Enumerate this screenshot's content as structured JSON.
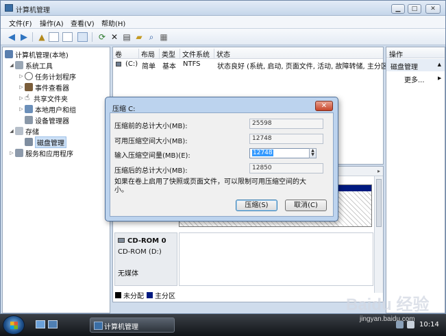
{
  "window": {
    "title": "计算机管理",
    "min": "▁",
    "max": "□",
    "close": "✕"
  },
  "menu": [
    "文件(F)",
    "操作(A)",
    "查看(V)",
    "帮助(H)"
  ],
  "tree": {
    "root": "计算机管理(本地)",
    "system_tools": "系统工具",
    "task_scheduler": "任务计划程序",
    "event_viewer": "事件查看器",
    "shared_folders": "共享文件夹",
    "local_users": "本地用户和组",
    "device_manager": "设备管理器",
    "storage": "存储",
    "disk_management": "磁盘管理",
    "services": "服务和应用程序"
  },
  "volumes": {
    "headers": [
      "卷",
      "布局",
      "类型",
      "文件系统",
      "状态"
    ],
    "row": {
      "volume": "(C:)",
      "layout": "简单",
      "type": "基本",
      "fs": "NTFS",
      "status": "状态良好 (系统, 启动, 页面文件, 活动, 故障转储, 主分区)"
    }
  },
  "disks": {
    "cdrom_name": "CD-ROM 0",
    "cdrom_drive": "CD-ROM (D:)",
    "no_media": "无媒体",
    "legend_unallocated": "未分配",
    "legend_primary": "主分区"
  },
  "actions": {
    "header": "操作",
    "section": "磁盘管理",
    "more": "更多..."
  },
  "dialog": {
    "title": "压缩 C:",
    "close": "✕",
    "total_before_label": "压缩前的总计大小(MB):",
    "total_before_value": "25598",
    "available_label": "可用压缩空间大小(MB):",
    "available_value": "12748",
    "input_label": "输入压缩空间量(MB)(E):",
    "input_value": "12748",
    "total_after_label": "压缩后的总计大小(MB):",
    "total_after_value": "12850",
    "note": "如果在卷上启用了快照或页面文件，可以限制可用压缩空间的大小。",
    "shrink_button": "压缩(S)",
    "cancel_button": "取消(C)"
  },
  "taskbar": {
    "task": "计算机管理",
    "time": "10:14"
  },
  "watermark": {
    "logo": "Baidu 经验",
    "url": "jingyan.baidu.com"
  },
  "colors": {
    "unallocated": "#000000",
    "primary_partition": "#001a80",
    "selection": "#3399ff"
  }
}
